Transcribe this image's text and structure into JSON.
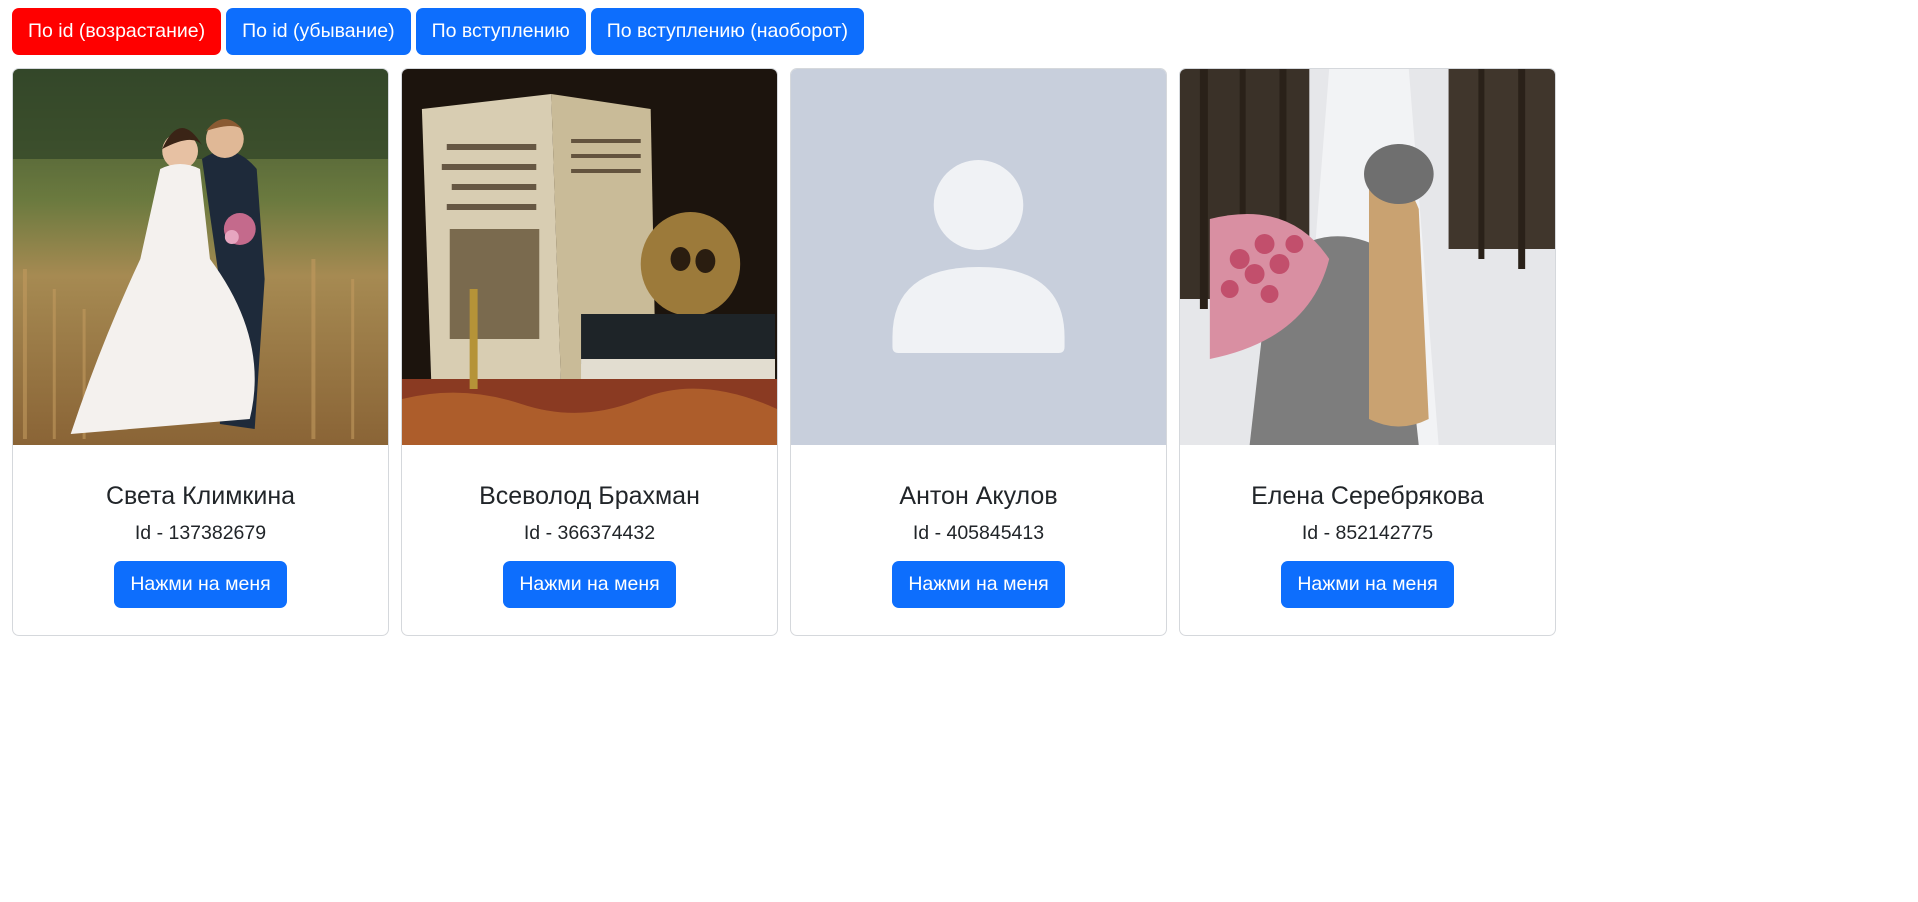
{
  "sort_buttons": [
    {
      "label": "По id (возрастание)",
      "active": true
    },
    {
      "label": "По id (убывание)",
      "active": false
    },
    {
      "label": "По вступлению",
      "active": false
    },
    {
      "label": "По вступлению (наоборот)",
      "active": false
    }
  ],
  "colors": {
    "primary": "#0d6efd",
    "active_sort": "#ff0000",
    "placeholder_bg": "#c8cfdc",
    "placeholder_fg": "#f0f2f5"
  },
  "cards": [
    {
      "name": "Света Климкина",
      "id_text": "Id - 137382679",
      "button_label": "Нажми на меня",
      "photo": "wedding-couple-photo"
    },
    {
      "name": "Всеволод Брахман",
      "id_text": "Id - 366374432",
      "button_label": "Нажми на меня",
      "photo": "vanitas-still-life-photo"
    },
    {
      "name": "Антон Акулов",
      "id_text": "Id - 405845413",
      "button_label": "Нажми на меня",
      "photo": "default-avatar-placeholder"
    },
    {
      "name": "Елена Серебрякова",
      "id_text": "Id - 852142775",
      "button_label": "Нажми на меня",
      "photo": "girl-with-roses-winter-photo"
    }
  ]
}
